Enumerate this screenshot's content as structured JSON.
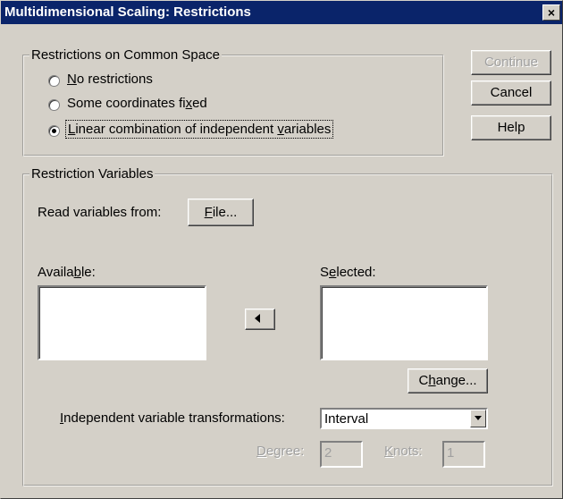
{
  "window": {
    "title": "Multidimensional Scaling: Restrictions",
    "close_label": "×"
  },
  "common_space": {
    "legend": "Restrictions on Common Space",
    "options": [
      {
        "pre": "",
        "mnemonic": "N",
        "post": "o restrictions",
        "selected": false
      },
      {
        "pre": "Some coordinates fi",
        "mnemonic": "x",
        "post": "ed",
        "selected": false
      },
      {
        "pre": "",
        "mnemonic": "L",
        "post": "inear combination of independent ",
        "post_m": "v",
        "post2": "ariables",
        "selected": true
      }
    ]
  },
  "buttons": {
    "continue": "Continue",
    "cancel": "Cancel",
    "help": "Help"
  },
  "restriction_vars": {
    "legend": "Restriction Variables",
    "read_from_label": "Read variables from:",
    "file_btn": {
      "mnemonic": "F",
      "rest": "ile..."
    },
    "available": {
      "pre": "Availa",
      "mnemonic": "b",
      "post": "le:"
    },
    "selected": {
      "pre": "S",
      "mnemonic": "e",
      "post": "lected:"
    },
    "change_btn": {
      "pre": "C",
      "mnemonic": "h",
      "post": "ange..."
    },
    "transform": {
      "label_pre": "",
      "label_mnemonic": "I",
      "label_post": "ndependent variable transformations:",
      "value": "Interval"
    },
    "degree": {
      "pre": "",
      "mnemonic": "D",
      "post": "egree:",
      "value": "2"
    },
    "knots": {
      "pre": "",
      "mnemonic": "K",
      "post": "nots:",
      "value": "1"
    }
  }
}
